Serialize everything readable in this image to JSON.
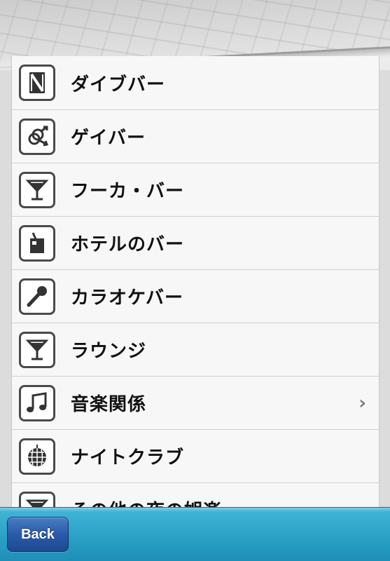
{
  "list": {
    "items": [
      {
        "label": "ダイブバー",
        "icon": "dive-bar-icon",
        "chevron": ""
      },
      {
        "label": "ゲイバー",
        "icon": "gay-bar-icon",
        "chevron": ""
      },
      {
        "label": "フーカ・バー",
        "icon": "cocktail-glass-icon",
        "chevron": ""
      },
      {
        "label": "ホテルのバー",
        "icon": "drink-glass-icon",
        "chevron": ""
      },
      {
        "label": "カラオケバー",
        "icon": "microphone-icon",
        "chevron": ""
      },
      {
        "label": "ラウンジ",
        "icon": "cocktail-glass-icon",
        "chevron": ""
      },
      {
        "label": "音楽関係",
        "icon": "music-note-icon",
        "chevron": "›"
      },
      {
        "label": "ナイトクラブ",
        "icon": "disco-ball-icon",
        "chevron": ""
      },
      {
        "label": "その他の夜の娯楽",
        "icon": "cocktail-glass-icon",
        "chevron": ""
      }
    ]
  },
  "toolbar": {
    "back_label": "Back"
  },
  "colors": {
    "toolbar": "#2aa1c6",
    "back_button": "#2a5aa8",
    "row_background": "#f7f7f7",
    "icon_border": "#4a4a4a"
  }
}
